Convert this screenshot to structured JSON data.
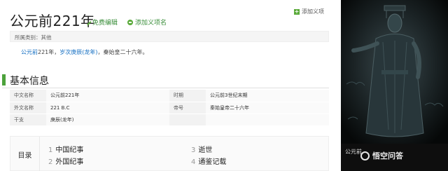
{
  "header": {
    "title": "公元前221年",
    "edit_label": "免费编辑",
    "add_item_label": "添加义项名",
    "top_add_label": "添加义项"
  },
  "category": {
    "text": "所属类别：其他"
  },
  "summary": {
    "link1": "公元前",
    "text1": "221年，",
    "link2": "岁次庚辰(龙年)",
    "text2": "，秦始皇二十六年。"
  },
  "section": {
    "title": "基本信息"
  },
  "info_table": {
    "rows": [
      {
        "k1": "中文名称",
        "v1": "公元前221年",
        "k2": "时期",
        "v2": "公元前3世纪末期"
      },
      {
        "k1": "外文名称",
        "v1": "221 B.C",
        "k2": "帝号",
        "v2": "秦始皇帝二十六年"
      },
      {
        "k1": "干支",
        "v1": "庚辰(龙年)",
        "k2": "",
        "v2": ""
      }
    ]
  },
  "toc": {
    "label": "目录",
    "items": [
      {
        "num": "1",
        "text": "中国纪事"
      },
      {
        "num": "2",
        "text": "外国纪事"
      },
      {
        "num": "3",
        "text": "逝世"
      },
      {
        "num": "4",
        "text": "通鉴记载"
      }
    ]
  },
  "right_panel": {
    "caption": "公元前",
    "watermark": "悟空问答"
  },
  "colors": {
    "accent_green": "#4ca23b",
    "link_blue": "#136ec2"
  }
}
